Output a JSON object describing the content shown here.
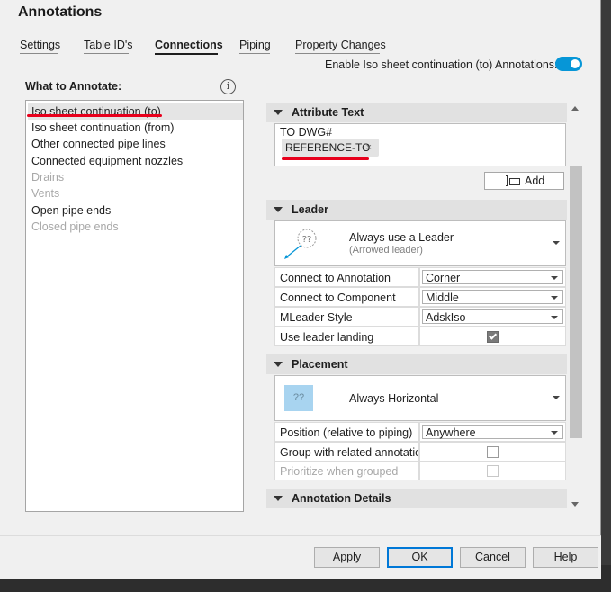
{
  "window": {
    "title": "Annotations"
  },
  "tabs": [
    {
      "label": "Settings"
    },
    {
      "label": "Table ID's"
    },
    {
      "label": "Connections"
    },
    {
      "label": "Piping"
    },
    {
      "label": "Property Changes"
    }
  ],
  "active_tab": "Connections",
  "enable": {
    "label": "Enable Iso sheet continuation (to) Annotations:",
    "on": true
  },
  "what_to_annotate": {
    "label": "What to Annotate:",
    "info_icon": "info-icon",
    "items": [
      {
        "label": "Iso sheet continuation (to)",
        "selected": true,
        "enabled": true
      },
      {
        "label": "Iso sheet continuation (from)",
        "enabled": true
      },
      {
        "label": "Other connected pipe lines",
        "enabled": true
      },
      {
        "label": "Connected equipment nozzles",
        "enabled": true
      },
      {
        "label": "Drains",
        "enabled": false
      },
      {
        "label": "Vents",
        "enabled": false
      },
      {
        "label": "Open pipe ends",
        "enabled": true
      },
      {
        "label": "Closed pipe ends",
        "enabled": false
      }
    ]
  },
  "attribute_text": {
    "header": "Attribute Text",
    "static_text": "TO DWG#",
    "chip": {
      "label": "REFERENCE-TO",
      "remove": "×"
    },
    "add_button": "Add"
  },
  "leader": {
    "header": "Leader",
    "style": {
      "title": "Always use a Leader",
      "subtitle": "(Arrowed leader)",
      "icon_text": "??"
    },
    "rows": [
      {
        "label": "Connect to Annotation",
        "value": "Corner"
      },
      {
        "label": "Connect to Component",
        "value": "Middle"
      },
      {
        "label": "MLeader Style",
        "value": "AdskIso"
      }
    ],
    "landing": {
      "label": "Use leader landing",
      "checked": true
    }
  },
  "placement": {
    "header": "Placement",
    "style": {
      "title": "Always Horizontal",
      "icon_text": "??"
    },
    "position": {
      "label": "Position (relative to piping)",
      "value": "Anywhere"
    },
    "group": {
      "label": "Group with related annotations",
      "checked": false
    },
    "prioritize": {
      "label": "Prioritize when grouped",
      "checked": false,
      "enabled": false
    }
  },
  "annotation_details": {
    "header": "Annotation Details"
  },
  "buttons": {
    "apply": "Apply",
    "ok": "OK",
    "cancel": "Cancel",
    "help": "Help"
  },
  "colors": {
    "accent": "#0696d7",
    "markup_red": "#e8001c",
    "preview_blue": "#a8d4f0"
  }
}
